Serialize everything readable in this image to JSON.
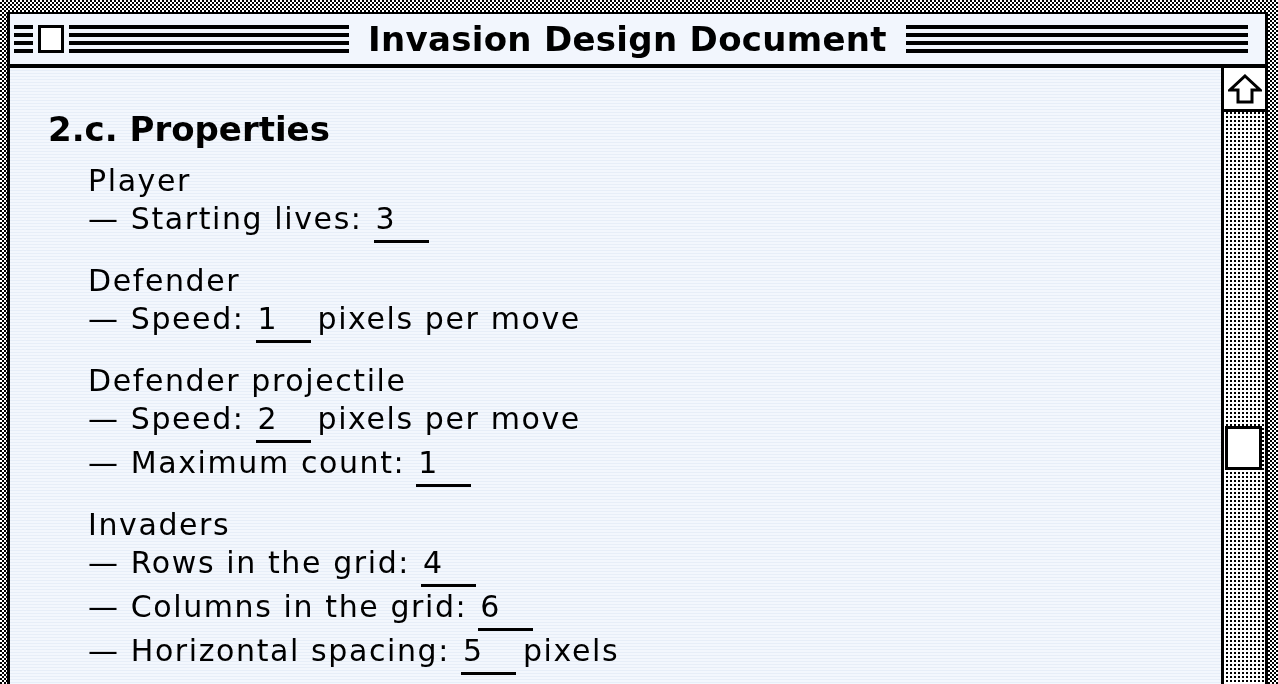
{
  "window": {
    "title": "Invasion Design Document"
  },
  "document": {
    "heading": "2.c. Properties",
    "sections": [
      {
        "title": "Player",
        "properties": [
          {
            "label": "— Starting lives:",
            "value": "3"
          }
        ]
      },
      {
        "title": "Defender",
        "properties": [
          {
            "label": "— Speed:",
            "value": "1",
            "unit": "pixels per move"
          }
        ]
      },
      {
        "title": "Defender projectile",
        "properties": [
          {
            "label": "— Speed:",
            "value": "2",
            "unit": "pixels per move"
          },
          {
            "label": "— Maximum count:",
            "value": "1"
          }
        ]
      },
      {
        "title": "Invaders",
        "properties": [
          {
            "label": "— Rows in the grid:",
            "value": "4"
          },
          {
            "label": "— Columns in the grid:",
            "value": "6"
          },
          {
            "label": "— Horizontal spacing:",
            "value": "5",
            "unit": "pixels"
          }
        ]
      }
    ]
  }
}
